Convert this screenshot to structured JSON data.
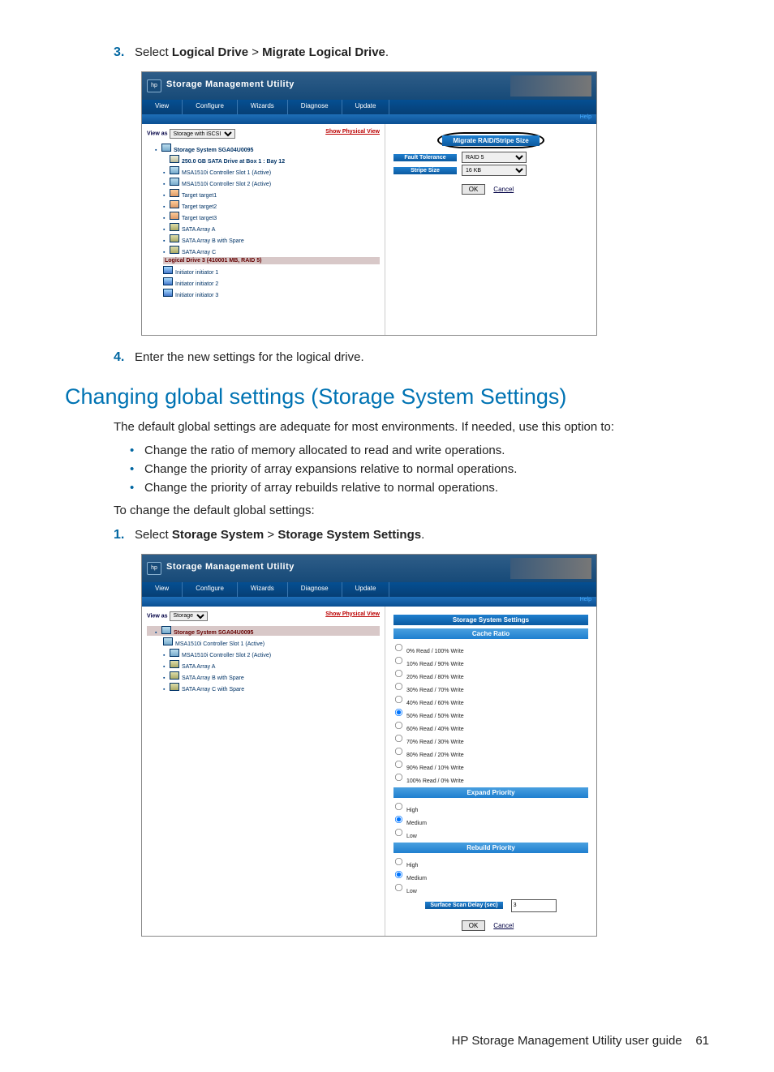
{
  "step3": {
    "num": "3.",
    "pre": "Select ",
    "b1": "Logical Drive",
    "gt": " > ",
    "b2": "Migrate Logical Drive",
    "post": "."
  },
  "step4": {
    "num": "4.",
    "text": "Enter the new settings for the logical drive."
  },
  "section_heading": "Changing global settings (Storage System Settings)",
  "para1": "The default global settings are adequate for most environments. If needed, use this option to:",
  "bullets": [
    "Change the ratio of memory allocated to read and write operations.",
    "Change the priority of array expansions relative to normal operations.",
    "Change the priority of array rebuilds relative to normal operations."
  ],
  "para2": "To change the default global settings:",
  "step1b": {
    "num": "1.",
    "pre": "Select ",
    "b1": "Storage System",
    "gt": " > ",
    "b2": "Storage System Settings",
    "post": "."
  },
  "app": {
    "title": "Storage Management Utility",
    "menu": [
      "View",
      "Configure",
      "Wizards",
      "Diagnose",
      "Update"
    ],
    "help": "Help",
    "viewas_label": "View as",
    "show_physical": "Show Physical View"
  },
  "shot1": {
    "viewas_option": "Storage with iSCSI",
    "tree": {
      "root": "Storage System SGA04U0095",
      "drive": "250.0 GB SATA Drive at Box 1 : Bay 12",
      "ctrl1": "MSA1510i Controller Slot 1 (Active)",
      "ctrl2": "MSA1510i Controller Slot 2 (Active)",
      "t1": "Target target1",
      "t2": "Target target2",
      "t3": "Target target3",
      "aA": "SATA Array A",
      "aB": "SATA Array B with Spare",
      "aC": "SATA Array C",
      "ld": "Logical Drive 3 (410001 MB, RAID 5)",
      "i1": "Initiator initiator 1",
      "i2": "Initiator initiator 2",
      "i3": "Initiator initiator 3"
    },
    "right": {
      "title": "Migrate RAID/Stripe Size",
      "fault_label": "Fault Tolerance",
      "fault_value": "RAID 5",
      "stripe_label": "Stripe Size",
      "stripe_value": "16 KB",
      "ok": "OK",
      "cancel": "Cancel"
    }
  },
  "shot2": {
    "viewas_option": "Storage",
    "tree": {
      "root": "Storage System SGA04U0095",
      "ctrl1": "MSA1510i Controller Slot 1 (Active)",
      "ctrl2": "MSA1510i Controller Slot 2 (Active)",
      "aA": "SATA Array A",
      "aB": "SATA Array B with Spare",
      "aC": "SATA Array C with Spare"
    },
    "right": {
      "title": "Storage System Settings",
      "cache_title": "Cache Ratio",
      "cache_options": [
        "0% Read / 100% Write",
        "10% Read / 90% Write",
        "20% Read / 80% Write",
        "30% Read / 70% Write",
        "40% Read / 60% Write",
        "50% Read / 50% Write",
        "60% Read / 40% Write",
        "70% Read / 30% Write",
        "80% Read / 20% Write",
        "90% Read / 10% Write",
        "100% Read / 0% Write"
      ],
      "cache_selected_index": 5,
      "expand_title": "Expand Priority",
      "priority_options": [
        "High",
        "Medium",
        "Low"
      ],
      "expand_selected_index": 1,
      "rebuild_title": "Rebuild Priority",
      "rebuild_selected_index": 1,
      "surface_label": "Surface Scan Delay (sec)",
      "surface_value": "3",
      "ok": "OK",
      "cancel": "Cancel"
    }
  },
  "footer": {
    "title": "HP Storage Management Utility user guide",
    "page": "61"
  }
}
